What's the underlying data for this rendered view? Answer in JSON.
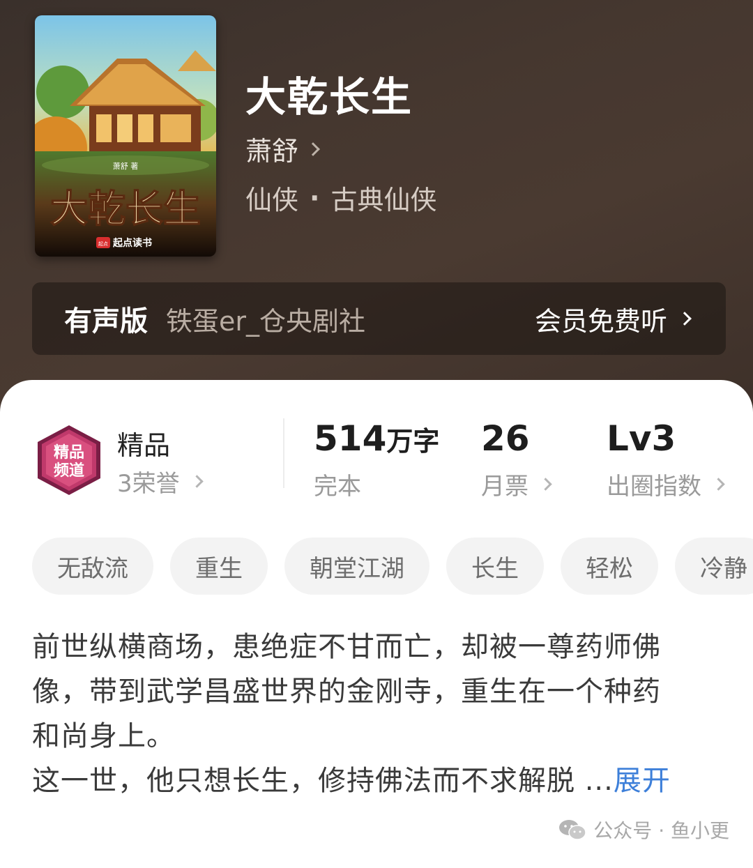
{
  "book": {
    "title": "大乾长生",
    "author": "萧舒",
    "genre_main": "仙侠",
    "genre_dot": "·",
    "genre_sub": "古典仙侠"
  },
  "cover": {
    "title_text": "大乾长生",
    "author_text": "萧舒 著",
    "publisher": "起点读书",
    "publisher_mark": "起点"
  },
  "audio": {
    "label": "有声版",
    "narrator": "铁蛋er_仓央剧社",
    "cta": "会员免费听"
  },
  "honor": {
    "badge_text_top": "精品",
    "badge_text_bottom": "频道",
    "title": "精品",
    "subtitle": "3荣誉"
  },
  "stats": [
    {
      "value": "514",
      "unit": "万字",
      "label": "完本"
    },
    {
      "value": "26",
      "unit": "",
      "label": "月票"
    },
    {
      "value": "Lv3",
      "unit": "",
      "label": "出圈指数"
    }
  ],
  "tags": [
    "无敌流",
    "重生",
    "朝堂江湖",
    "长生",
    "轻松",
    "冷静"
  ],
  "synopsis": {
    "line1": "前世纵横商场，患绝症不甘而亡，却被一尊药师佛",
    "line2": "像，带到武学昌盛世界的金刚寺，重生在一个种药",
    "line3": "和尚身上。",
    "line4": "这一世，他只想长生，修持佛法而不求解脱 ...",
    "expand": "展开"
  },
  "watermark": {
    "text": "公众号 · 鱼小更"
  },
  "colors": {
    "hero_bg": "#45372f",
    "accent_link": "#3d7fd9",
    "badge": "#c0396b"
  }
}
